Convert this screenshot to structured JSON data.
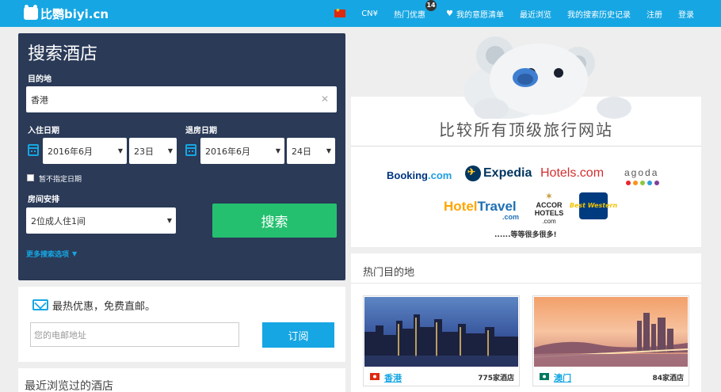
{
  "header": {
    "logo_text": "比鹦biyi.cn",
    "currency": "CN¥",
    "deals_label": "热门优惠",
    "deals_count": "14",
    "wishlist_label": "我的意愿清单",
    "recent_label": "最近浏览",
    "history_label": "我的搜索历史记录",
    "register_label": "注册",
    "login_label": "登录"
  },
  "search": {
    "title": "搜索酒店",
    "destination_label": "目的地",
    "destination_value": "香港",
    "checkin_label": "入住日期",
    "checkin_month": "2016年6月",
    "checkin_day": "23日",
    "checkout_label": "退房日期",
    "checkout_month": "2016年6月",
    "checkout_day": "24日",
    "no_dates_label": "暂不指定日期",
    "rooms_label": "房间安排",
    "rooms_value": "2位成人住1间",
    "search_button": "搜索",
    "more_options": "更多搜索选项"
  },
  "subscribe": {
    "title": "最热优惠，免费直邮。",
    "email_placeholder": "您的电邮地址",
    "button": "订阅"
  },
  "recent": {
    "title": "最近浏览过的酒店"
  },
  "brands": {
    "title": "比较所有顶级旅行网站",
    "booking": "Booking",
    "booking_suffix": ".com",
    "expedia": "Expedia",
    "hotels": "Hotels.com",
    "agoda": "agoda",
    "hoteltravel_a": "Hotel",
    "hoteltravel_b": "Travel",
    "hoteltravel_c": ".com",
    "accor_1": "ACCOR",
    "accor_2": "HOTELS",
    "accor_3": ".com",
    "bestwestern": "Best Western",
    "and_more": "......等等很多很多!",
    "agoda_colors": [
      "#e8262d",
      "#f7941d",
      "#8dc63f",
      "#2e9fd9",
      "#7f3f98"
    ]
  },
  "destinations": {
    "title": "热门目的地",
    "items": [
      {
        "name": "香港",
        "count": "775家酒店"
      },
      {
        "name": "澳门",
        "count": "84家酒店"
      }
    ]
  },
  "colors": {
    "brand": "#16a6e3",
    "panel": "#2a3a57",
    "search_button": "#24c06f"
  }
}
